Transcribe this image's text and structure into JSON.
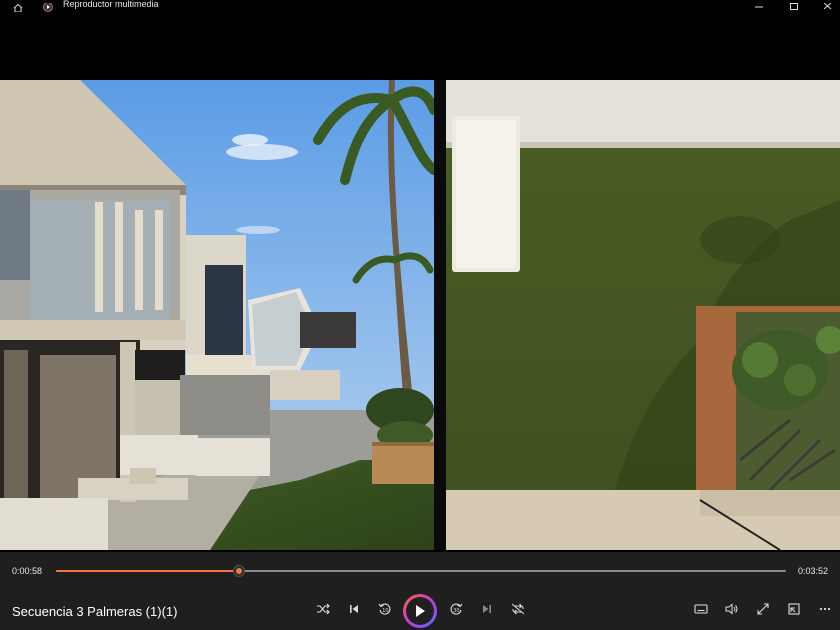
{
  "window": {
    "title": "Reproductor multimedia"
  },
  "player": {
    "current_time": "0:00:58",
    "total_time": "0:03:52",
    "progress_fraction": 0.25,
    "media_title": "Secuencia 3 Palmeras (1)(1)"
  },
  "colors": {
    "accent": "#ef7a3f",
    "controls_bg": "#1f1f1f"
  },
  "controls": {
    "left_group": [
      "shuffle-icon",
      "previous-icon",
      "rewind-10-icon",
      "play-icon",
      "forward-30-icon",
      "next-icon",
      "repeat-icon"
    ],
    "right_group": [
      "captions-icon",
      "volume-icon",
      "fullscreen-icon",
      "miniplayer-icon",
      "more-icon"
    ]
  }
}
